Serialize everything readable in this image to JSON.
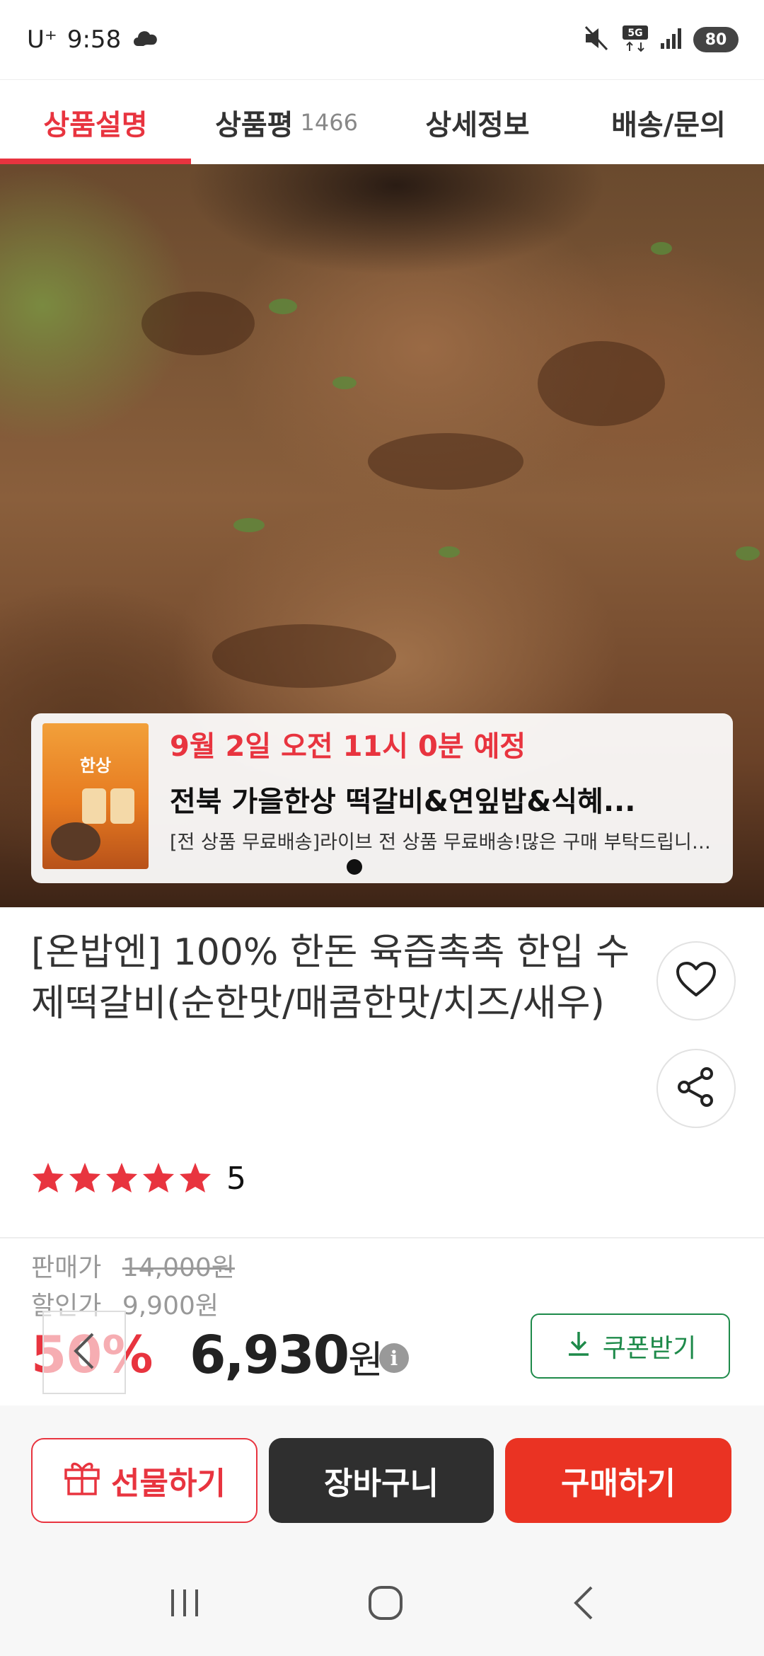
{
  "status_bar": {
    "carrier": "U⁺",
    "time": "9:58",
    "battery": "80",
    "network": "5G"
  },
  "tabs": [
    {
      "label": "상품설명",
      "count": ""
    },
    {
      "label": "상품평",
      "count": "1466"
    },
    {
      "label": "상세정보",
      "count": ""
    },
    {
      "label": "배송/문의",
      "count": ""
    }
  ],
  "live_banner": {
    "date": "9월 2일 오전 11시 0분 예정",
    "title": "전북 가을한상 떡갈비&연잎밥&식혜...",
    "description": "[전 상품 무료배송]라이브 전 상품 무료배송!많은 구매 부탁드립니다😊[...",
    "thumb_text": "한상"
  },
  "product": {
    "title": "[온밥엔] 100% 한돈 육즙촉촉 한입 수제떡갈비(순한맛/매콤한맛/치즈/새우)",
    "rating_score": "5",
    "stars": 5
  },
  "price": {
    "sale_label": "판매가",
    "sale_value": "14,000원",
    "discount_label": "할인가",
    "discount_value": "9,900원",
    "discount_rate": "50%",
    "final_value": "6,930",
    "final_unit": "원",
    "info_icon": "i"
  },
  "buttons": {
    "coupon": "쿠폰받기",
    "gift": "선물하기",
    "cart": "장바구니",
    "buy": "구매하기"
  },
  "colors": {
    "accent": "#e8343f",
    "buy": "#ea3323",
    "cart": "#2f2f2f",
    "coupon": "#1e8a4a",
    "star": "#e8343f"
  }
}
